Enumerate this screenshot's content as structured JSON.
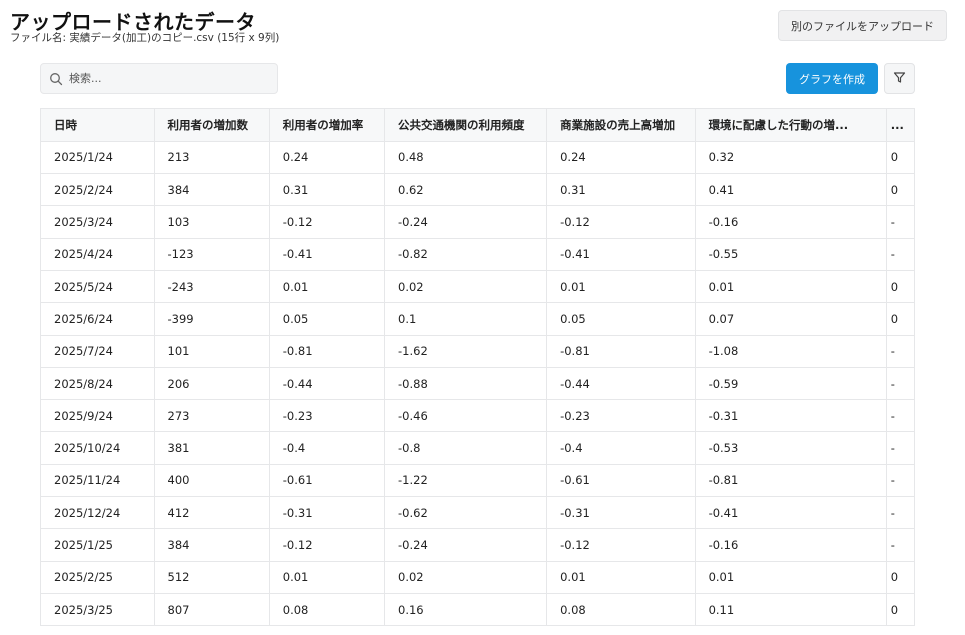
{
  "page": {
    "title": "アップロードされたデータ",
    "subtitle": "ファイル名: 実績データ(加工)のコピー.csv (15行 x 9列)"
  },
  "toolbar": {
    "upload_other_label": "別のファイルをアップロード",
    "search_placeholder": "検索...",
    "create_graph_label": "グラフを作成"
  },
  "table": {
    "headers": [
      "日時",
      "利用者の増加数",
      "利用者の増加率",
      "公共交通機関の利用頻度",
      "商業施設の売上高増加",
      "環境に配慮した行動の増...",
      "..."
    ],
    "rows": [
      [
        "2025/1/24",
        "213",
        "0.24",
        "0.48",
        "0.24",
        "0.32",
        "0"
      ],
      [
        "2025/2/24",
        "384",
        "0.31",
        "0.62",
        "0.31",
        "0.41",
        "0"
      ],
      [
        "2025/3/24",
        "103",
        "-0.12",
        "-0.24",
        "-0.12",
        "-0.16",
        "-"
      ],
      [
        "2025/4/24",
        "-123",
        "-0.41",
        "-0.82",
        "-0.41",
        "-0.55",
        "-"
      ],
      [
        "2025/5/24",
        "-243",
        "0.01",
        "0.02",
        "0.01",
        "0.01",
        "0"
      ],
      [
        "2025/6/24",
        "-399",
        "0.05",
        "0.1",
        "0.05",
        "0.07",
        "0"
      ],
      [
        "2025/7/24",
        "101",
        "-0.81",
        "-1.62",
        "-0.81",
        "-1.08",
        "-"
      ],
      [
        "2025/8/24",
        "206",
        "-0.44",
        "-0.88",
        "-0.44",
        "-0.59",
        "-"
      ],
      [
        "2025/9/24",
        "273",
        "-0.23",
        "-0.46",
        "-0.23",
        "-0.31",
        "-"
      ],
      [
        "2025/10/24",
        "381",
        "-0.4",
        "-0.8",
        "-0.4",
        "-0.53",
        "-"
      ],
      [
        "2025/11/24",
        "400",
        "-0.61",
        "-1.22",
        "-0.61",
        "-0.81",
        "-"
      ],
      [
        "2025/12/24",
        "412",
        "-0.31",
        "-0.62",
        "-0.31",
        "-0.41",
        "-"
      ],
      [
        "2025/1/25",
        "384",
        "-0.12",
        "-0.24",
        "-0.12",
        "-0.16",
        "-"
      ],
      [
        "2025/2/25",
        "512",
        "0.01",
        "0.02",
        "0.01",
        "0.01",
        "0"
      ],
      [
        "2025/3/25",
        "807",
        "0.08",
        "0.16",
        "0.08",
        "0.11",
        "0"
      ]
    ]
  },
  "icons": {
    "search": "search-icon",
    "filter": "filter-icon"
  },
  "colors": {
    "primary": "#1793dd",
    "header_bg": "#f7f8f9",
    "border": "#e6e7e9"
  }
}
